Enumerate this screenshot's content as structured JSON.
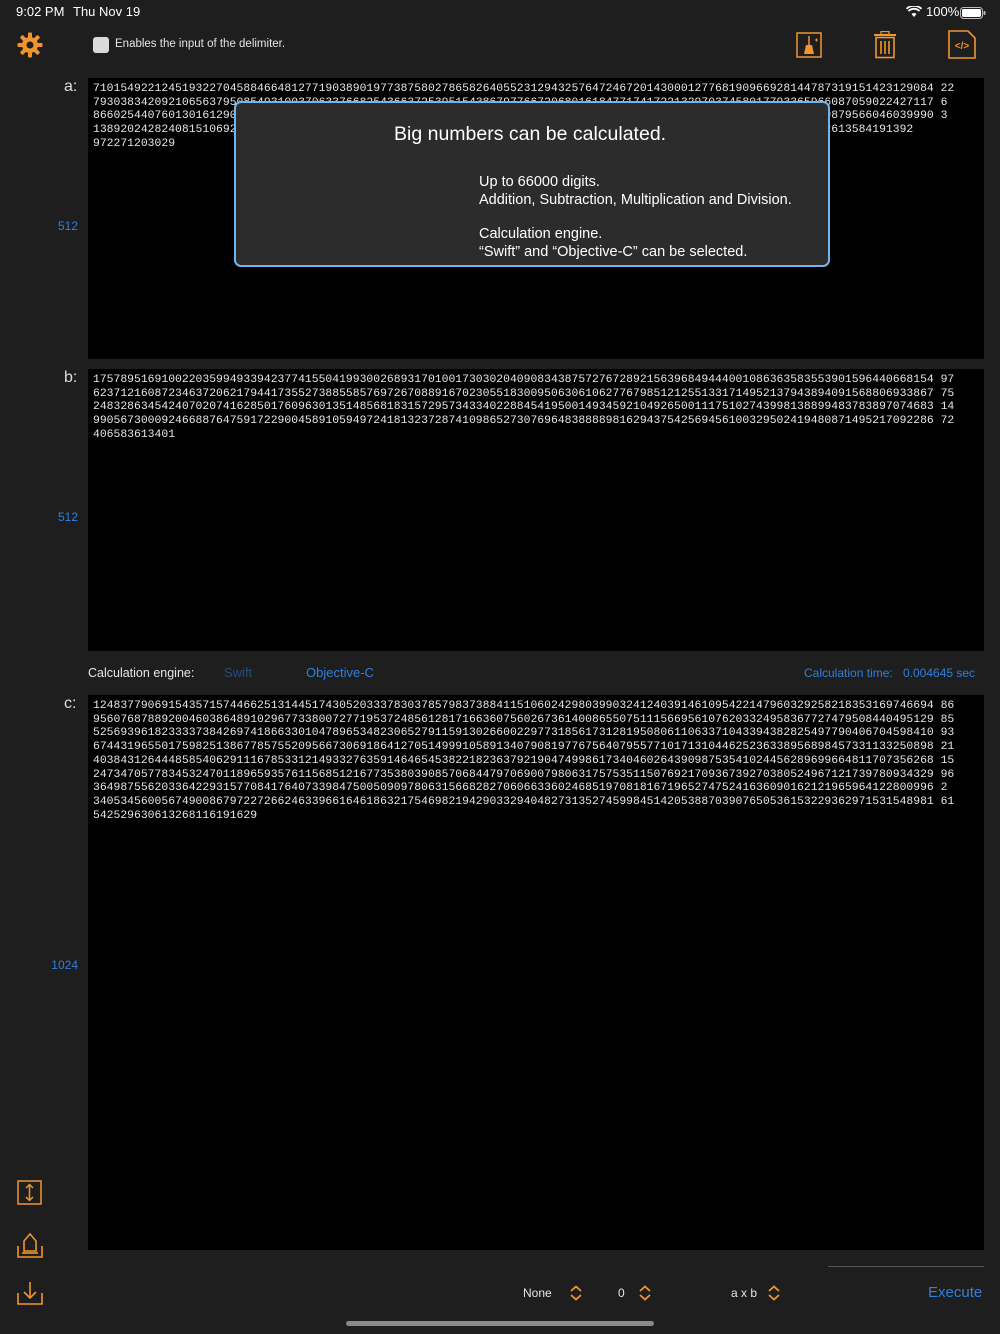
{
  "status_bar": {
    "time": "9:02 PM",
    "date": "Thu Nov 19",
    "battery": "100%"
  },
  "toolbar": {
    "settings_icon": "gear-icon",
    "delimiter_checkbox_label": "Enables the input of the delimiter.",
    "icons": [
      "broom-icon",
      "trash-icon",
      "code-icon"
    ]
  },
  "colors": {
    "accent": "#f0952e",
    "link": "#2f7fe0",
    "background": "#1e1e1e",
    "field": "#000000"
  },
  "field_a": {
    "label": "a:",
    "digit_count": "512",
    "lines": [
      "710154922124519322704588466481277190389019773875802786582640552312943257647246720143000127768190966928144787319151423129084 22",
      "793038342092106563795085493100370633766825436637253951543867977667206801618477174172213297037458017793365966087059022427117 6",
      "866025440760130161290279873594595970899460804675263339808703336828242461413900394299488025220620475091916269879566046039990 3",
      "138920242824081510692857294542004798463368303245617892761553145167985023987645612777454696243867344243664562613584191392",
      "972271203029"
    ]
  },
  "popup": {
    "title": "Big numbers can be calculated.",
    "line1": "Up to 66000 digits.",
    "line2": "Addition, Subtraction, Multiplication and Division.",
    "line3": "Calculation engine.",
    "line4": "“Swift” and “Objective-C” can be selected."
  },
  "field_b": {
    "label": "b:",
    "digit_count": "512",
    "lines": [
      "175789516910022035994933942377415504199300268931701001730302040908343875727672892156396849444001086363583553901596440668154 97",
      "623712160872346372062179441735527388558576972670889167023055183009506306106277679851212551331714952137943894091568806933867 75",
      "248328634542407020741628501760963013514856818315729573433402288454195001493459210492650011175102743998138899483783897074683 14",
      "990567300092466887647591722900458910594972418132372874109865273076964838888981629437542569456100329502419480871495217092286 72",
      "406583613401"
    ]
  },
  "engine": {
    "label": "Calculation engine:",
    "option_swift": "Swift",
    "option_objc": "Objective-C",
    "time_label": "Calculation time:",
    "time_value": "0.004645 sec"
  },
  "field_c": {
    "label": "c:",
    "digit_count": "1024",
    "lines": [
      "124837790691543571574466251314451743052033378303785798373884115106024298039903241240391461095422147960329258218353169746694 86",
      "956076878892004603864891029677338007277195372485612817166360756026736140086550751115669561076203324958367727479508440495129 85",
      "525693961823333738426974186633010478965348230652791159130266002297731856173128195080611063371043394382825497790406704598410 93",
      "674431965501759825138677857552095667306918641270514999105891340790819776756407955771017131044625236338956898457331133250898 21",
      "403843126444858540629111678533121493327635914646545382218236379219047499861734046026439098753541024456289699664811707356268 15",
      "247347057783453247011896593576115685121677353803908570684479706900798063175753511507692170936739270380524967121739780934329 96",
      "364987556203364229315770841764073398475005090978063156682827060663360246851970818167196527475241636090162121965964122800996 2",
      "340534560056749008679722726624633966164618632175469821942903329404827313527459984514205388703907650536153229362971531548981 61",
      "542529630613268116191629"
    ]
  },
  "bottom_tools": [
    "resize-icon",
    "export-icon",
    "import-icon"
  ],
  "footer": {
    "delimiter_value": "None",
    "decimal_value": "0",
    "operation_value": "a x b",
    "execute_label": "Execute"
  }
}
